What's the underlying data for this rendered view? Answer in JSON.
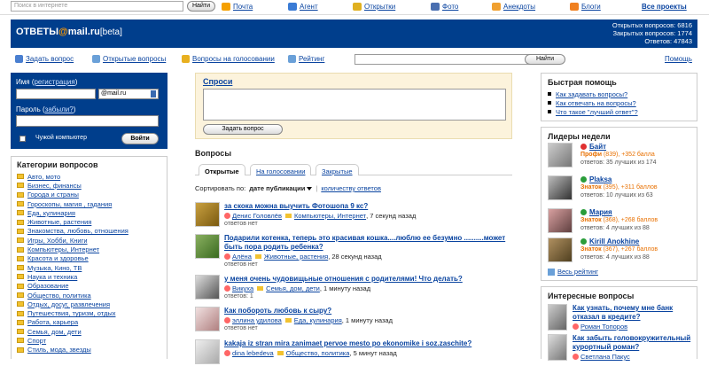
{
  "topbar": {
    "search_placeholder": "Поиск в интернете",
    "search_button": "Найти",
    "links": [
      {
        "label": "Почта",
        "icon": "mail-icon",
        "color": "#f5a000"
      },
      {
        "label": "Агент",
        "icon": "agent-icon",
        "color": "#3a7bd5"
      },
      {
        "label": "Открытки",
        "icon": "postcards-icon",
        "color": "#e0b020"
      },
      {
        "label": "Фото",
        "icon": "photo-icon",
        "color": "#4a6fb0"
      },
      {
        "label": "Анекдоты",
        "icon": "jokes-icon",
        "color": "#f0a030"
      },
      {
        "label": "Блоги",
        "icon": "blogs-icon",
        "color": "#f08020"
      }
    ],
    "all_projects": "Все проекты"
  },
  "header": {
    "logo_a": "ОТВЕТЫ",
    "logo_at": "@",
    "logo_b": "mail.ru",
    "logo_beta": "[beta]",
    "stats": [
      "Открытых вопросов: 6816",
      "Закрытых вопросов: 1774",
      "Ответов: 47843"
    ]
  },
  "toolbar": {
    "ask": "Задать вопрос",
    "open": "Открытые вопросы",
    "voting": "Вопросы на голосовании",
    "rating": "Рейтинг",
    "search_button": "Найти",
    "help": "Помощь"
  },
  "login": {
    "name_label": "Имя",
    "register": "регистрация",
    "domain": "@mail.ru",
    "password_label": "Пароль",
    "forgot": "забыли?",
    "alien": "Чужой компьютер",
    "login_button": "Войти"
  },
  "categories": {
    "title": "Категории вопросов",
    "items": [
      "Авто, мото",
      "Бизнес, финансы",
      "Города и страны",
      "Гороскопы, магия , гадания",
      "Еда, кулинария",
      "Животные, растения",
      "Знакомства, любовь, отношения",
      "Игры, Хобби, Книги",
      "Компьютеры, Интернет",
      "Красота и здоровье",
      "Музыка, Кино, ТВ",
      "Наука и техника",
      "Образование",
      "Общество, политика",
      "Отдых, досуг, развлечения",
      "Путешествия, туризм, отдых",
      "Работа, карьера",
      "Семья, дом, дети",
      "Спорт",
      "Стиль, мода, звезды"
    ]
  },
  "ask": {
    "title": "Спроси",
    "button": "Задать вопрос"
  },
  "questions": {
    "title": "Вопросы",
    "tabs": [
      "Открытые",
      "На голосовании",
      "Закрытые"
    ],
    "sort_label": "Сортировать по:",
    "sort_active": "дате публикации",
    "sort_other": "количеству ответов",
    "items": [
      {
        "title": "за скока можна выучить Фотошопа 9 кс?",
        "user": "Денис Головлёв",
        "category": "Компьютеры, Интернет",
        "time": ", 7 секунд назад",
        "answers": "ответов нет"
      },
      {
        "title": "Подарили котенка, теперь это красивая кошка....люблю ее безумно ..........может быть пора родить ребенка?",
        "user": "Алёна",
        "category": "Животные, растения",
        "time": ", 28 секунд назад",
        "answers": "ответов нет"
      },
      {
        "title": "у меня очень чудовищьные отношения с родителями! Что делать?",
        "user": "Викуха",
        "category": "Семья, дом, дети",
        "time": ", 1 минуту назад",
        "answers": "ответов: 1"
      },
      {
        "title": "Как побороть любовь к сыру?",
        "user": "эллина удилова",
        "category": "Еда, кулинария",
        "time": ", 1 минуту назад",
        "answers": "ответов нет"
      },
      {
        "title": "kakaja iz stran mira zanimaet pervoe mesto po ekonomike i soz.zaschite?",
        "user": "dina lebedeva",
        "category": "Общество, политика",
        "time": ", 5 минут назад",
        "answers": ""
      }
    ]
  },
  "quick_help": {
    "title": "Быстрая помощь",
    "items": [
      "Как задавать вопросы?",
      "Как отвечать на вопросы?",
      "Что такое \"лучший ответ\"?"
    ]
  },
  "leaders": {
    "title": "Лидеры недели",
    "items": [
      {
        "name": "Байт",
        "rank": "Профи",
        "points": "(839)",
        "delta": ", +352 балла",
        "answers": "ответов: 35 лучших из 174",
        "color": "#e03030"
      },
      {
        "name": "Plaksa",
        "rank": "Знаток",
        "points": "(395)",
        "delta": ", +311 баллов",
        "answers": "ответов: 10 лучших из 63",
        "color": "#2a9d3a"
      },
      {
        "name": "Мария",
        "rank": "Знаток",
        "points": "(368)",
        "delta": ", +268 баллов",
        "answers": "ответов: 4 лучших из 88",
        "color": "#2a9d3a"
      },
      {
        "name": "Kirill Anokhine",
        "rank": "Знаток",
        "points": "(367)",
        "delta": ", +267 баллов",
        "answers": "ответов: 4 лучших из 88",
        "color": "#2a9d3a"
      }
    ],
    "all_rating": "Весь рейтинг"
  },
  "interesting": {
    "title": "Интересные вопросы",
    "items": [
      {
        "title": "Как узнать, почему мне банк отказал в кредите?",
        "user": "Роман Топоров"
      },
      {
        "title": "Как забыть головокружительный курортный роман?",
        "user": "Светлана Пакус"
      }
    ]
  }
}
